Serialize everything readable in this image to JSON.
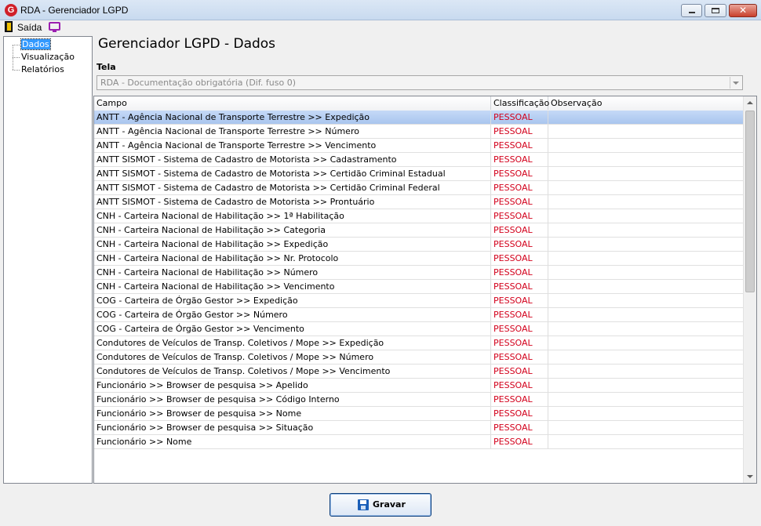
{
  "window": {
    "title": "RDA - Gerenciador LGPD",
    "app_icon": "G"
  },
  "menu": {
    "exit_label": "Saída",
    "exit_icon": "door-exit-icon",
    "screen_icon": "monitor-icon"
  },
  "tree": {
    "items": [
      {
        "label": "Dados",
        "selected": true
      },
      {
        "label": "Visualização",
        "selected": false
      },
      {
        "label": "Relatórios",
        "selected": false
      }
    ]
  },
  "page": {
    "title": "Gerenciador LGPD - Dados"
  },
  "tela": {
    "label": "Tela",
    "value": "RDA - Documentação obrigatória (Dif. fuso 0)"
  },
  "grid": {
    "columns": [
      "Campo",
      "Classificação",
      "Observação"
    ],
    "rows": [
      {
        "campo": "ANTT - Agência Nacional de Transporte Terrestre >> Expedição",
        "classificacao": "PESSOAL",
        "observacao": ""
      },
      {
        "campo": "ANTT - Agência Nacional de Transporte Terrestre >> Número",
        "classificacao": "PESSOAL",
        "observacao": ""
      },
      {
        "campo": "ANTT - Agência Nacional de Transporte Terrestre >> Vencimento",
        "classificacao": "PESSOAL",
        "observacao": ""
      },
      {
        "campo": "ANTT SISMOT - Sistema de Cadastro de Motorista >> Cadastramento",
        "classificacao": "PESSOAL",
        "observacao": ""
      },
      {
        "campo": "ANTT SISMOT - Sistema de Cadastro de Motorista >> Certidão Criminal Estadual",
        "classificacao": "PESSOAL",
        "observacao": ""
      },
      {
        "campo": "ANTT SISMOT - Sistema de Cadastro de Motorista >> Certidão Criminal Federal",
        "classificacao": "PESSOAL",
        "observacao": ""
      },
      {
        "campo": "ANTT SISMOT - Sistema de Cadastro de Motorista >> Prontuário",
        "classificacao": "PESSOAL",
        "observacao": ""
      },
      {
        "campo": "CNH - Carteira Nacional de Habilitação >> 1ª Habilitação",
        "classificacao": "PESSOAL",
        "observacao": ""
      },
      {
        "campo": "CNH - Carteira Nacional de Habilitação >> Categoria",
        "classificacao": "PESSOAL",
        "observacao": ""
      },
      {
        "campo": "CNH - Carteira Nacional de Habilitação >> Expedição",
        "classificacao": "PESSOAL",
        "observacao": ""
      },
      {
        "campo": "CNH - Carteira Nacional de Habilitação >> Nr. Protocolo",
        "classificacao": "PESSOAL",
        "observacao": ""
      },
      {
        "campo": "CNH - Carteira Nacional de Habilitação >> Número",
        "classificacao": "PESSOAL",
        "observacao": ""
      },
      {
        "campo": "CNH - Carteira Nacional de Habilitação >> Vencimento",
        "classificacao": "PESSOAL",
        "observacao": ""
      },
      {
        "campo": "COG - Carteira de Órgão Gestor >> Expedição",
        "classificacao": "PESSOAL",
        "observacao": ""
      },
      {
        "campo": "COG - Carteira de Órgão Gestor >> Número",
        "classificacao": "PESSOAL",
        "observacao": ""
      },
      {
        "campo": "COG - Carteira de Órgão Gestor >> Vencimento",
        "classificacao": "PESSOAL",
        "observacao": ""
      },
      {
        "campo": "Condutores de Veículos de Transp. Coletivos / Mope >> Expedição",
        "classificacao": "PESSOAL",
        "observacao": ""
      },
      {
        "campo": "Condutores de Veículos de Transp. Coletivos / Mope >> Número",
        "classificacao": "PESSOAL",
        "observacao": ""
      },
      {
        "campo": "Condutores de Veículos de Transp. Coletivos / Mope >> Vencimento",
        "classificacao": "PESSOAL",
        "observacao": ""
      },
      {
        "campo": "Funcionário >> Browser de pesquisa >> Apelido",
        "classificacao": "PESSOAL",
        "observacao": ""
      },
      {
        "campo": "Funcionário >> Browser de pesquisa >> Código Interno",
        "classificacao": "PESSOAL",
        "observacao": ""
      },
      {
        "campo": "Funcionário >> Browser de pesquisa >> Nome",
        "classificacao": "PESSOAL",
        "observacao": ""
      },
      {
        "campo": "Funcionário >> Browser de pesquisa >> Situação",
        "classificacao": "PESSOAL",
        "observacao": ""
      },
      {
        "campo": "Funcionário >> Nome",
        "classificacao": "PESSOAL",
        "observacao": ""
      }
    ],
    "selected_row": 0
  },
  "actions": {
    "save_label": "Gravar",
    "save_icon": "floppy-disk-icon"
  },
  "colors": {
    "classification_text": "#d3001b",
    "selection": "#a9c5ee",
    "tree_selection": "#3399ff"
  }
}
